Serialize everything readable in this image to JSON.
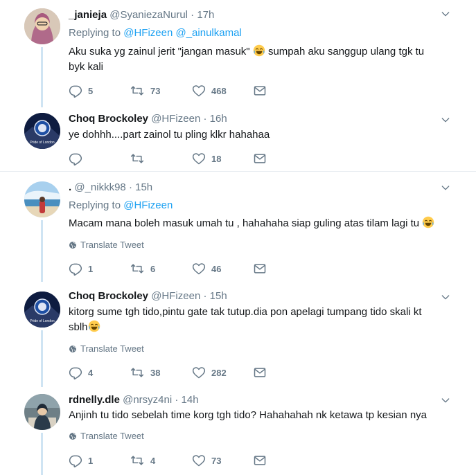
{
  "tweets": [
    {
      "name": "_janieja",
      "handle": "@SyaniezaNurul",
      "time": "· 17h",
      "replying_label": "Replying to",
      "mentions": [
        "@HFizeen",
        "@_ainulkamal"
      ],
      "text_a": "Aku suka yg zainul jerit \"jangan masuk\"",
      "text_b": " sumpah aku sanggup ulang tgk tu",
      "text_c": "byk kali",
      "replies": "5",
      "retweets": "73",
      "likes": "468"
    },
    {
      "name": "Choq Brockoley",
      "handle": "@HFizeen",
      "time": "· 16h",
      "text": "ye dohhh....part zainol tu pling klkr hahahaa",
      "replies": "",
      "retweets": "",
      "likes": "18"
    },
    {
      "name": ".",
      "handle": "@_nikkk98",
      "time": "· 15h",
      "replying_label": "Replying to",
      "mentions": [
        "@HFizeen"
      ],
      "text": "Macam mana boleh masuk umah tu , hahahaha siap guling atas tilam lagi tu",
      "translate": "Translate Tweet",
      "replies": "1",
      "retweets": "6",
      "likes": "46"
    },
    {
      "name": "Choq Brockoley",
      "handle": "@HFizeen",
      "time": "· 15h",
      "text_a": "kitorg sume tgh tido,pintu gate tak tutup.dia pon apelagi tumpang tido skali kt",
      "text_b": "sblh",
      "translate": "Translate Tweet",
      "replies": "4",
      "retweets": "38",
      "likes": "282"
    },
    {
      "name": "rdnelly.dle",
      "handle": "@nrsyz4ni",
      "time": "· 14h",
      "text": "Anjinh tu tido sebelah time korg tgh tido? Hahahahah nk ketawa tp kesian nya",
      "translate": "Translate Tweet",
      "replies": "1",
      "retweets": "4",
      "likes": "73"
    }
  ],
  "colors": {
    "link": "#1da1f2",
    "muted": "#657786",
    "thread": "#cfe4f3",
    "divider": "#e6ecf0"
  },
  "icons": [
    "reply-icon",
    "retweet-icon",
    "like-icon",
    "message-icon",
    "globe-icon",
    "chevron-down-icon",
    "tears-of-joy-emoji"
  ]
}
